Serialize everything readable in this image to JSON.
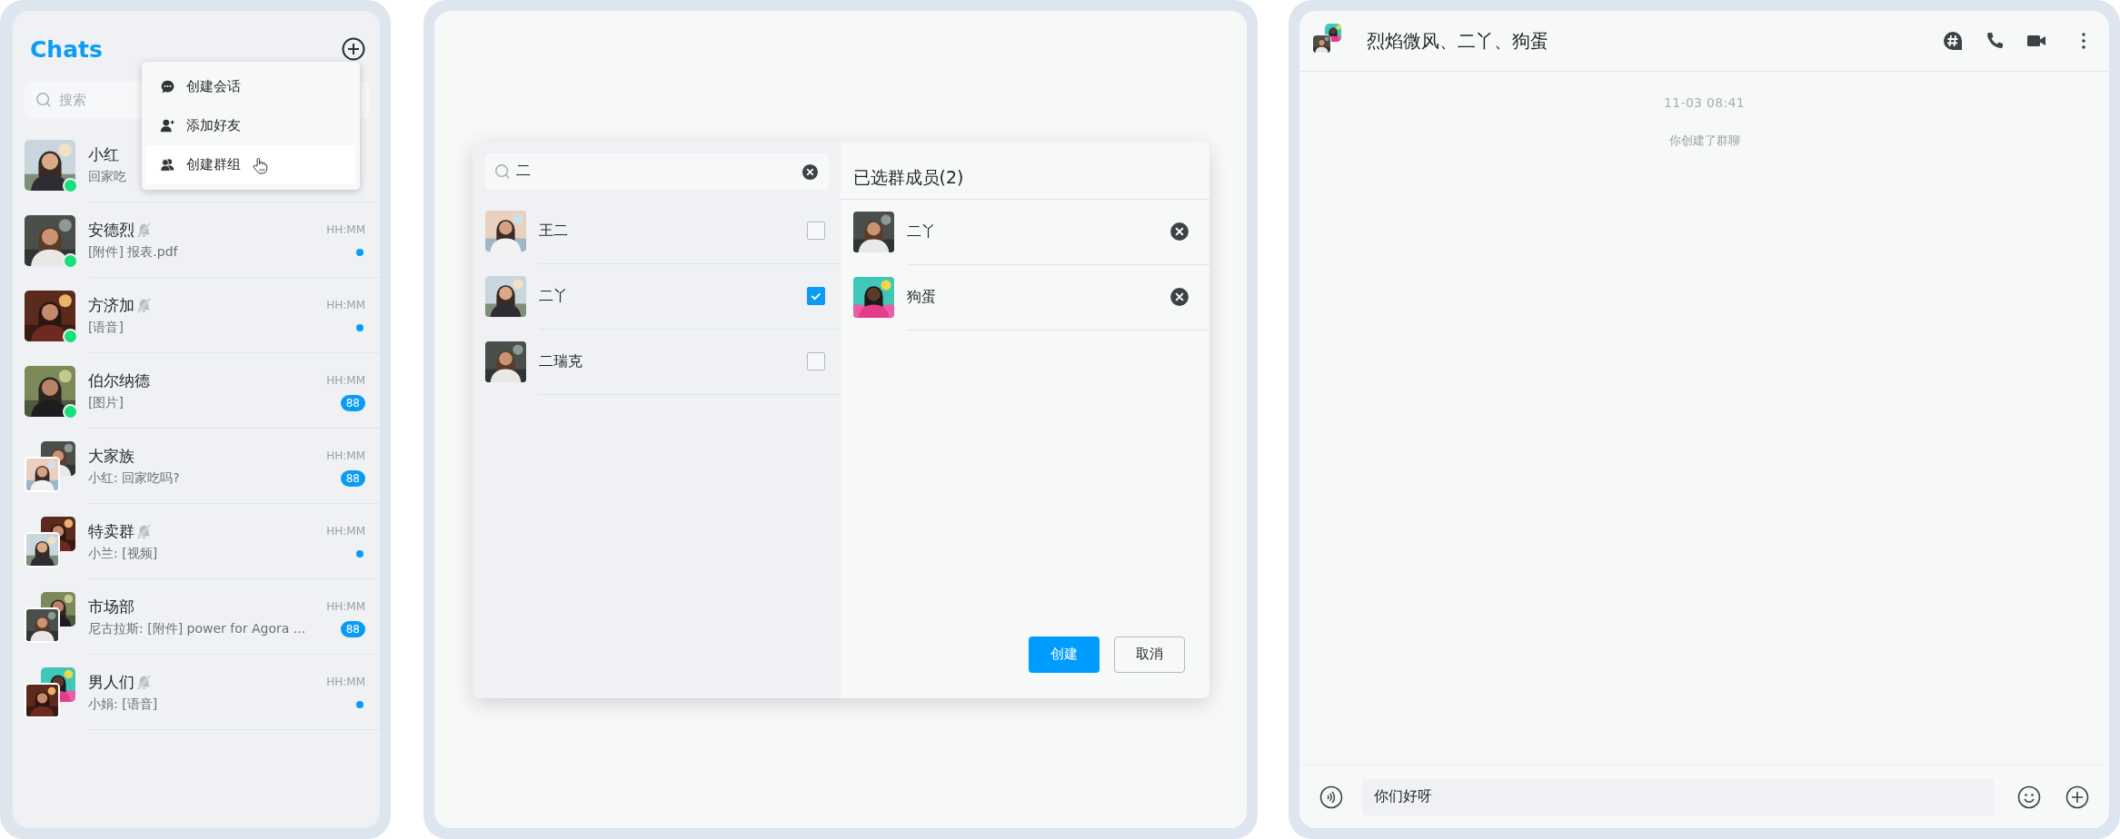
{
  "chat_list": {
    "title": "Chats",
    "search": {
      "placeholder": "搜索"
    },
    "menu": [
      {
        "label": "创建会话",
        "kind": "chat",
        "selected": false
      },
      {
        "label": "添加好友",
        "kind": "add_friend",
        "selected": false
      },
      {
        "label": "创建群组",
        "kind": "group",
        "selected": true
      }
    ],
    "chats": [
      {
        "name": "小红",
        "preview": "回家吃",
        "group_avatar": false,
        "online": true,
        "muted": false
      },
      {
        "name": "安德烈",
        "preview": "[附件] 报表.pdf",
        "time": "HH:MM",
        "group_avatar": false,
        "online": true,
        "muted": true,
        "unread": {
          "kind": "dot"
        }
      },
      {
        "name": "方济加",
        "preview": "[语音]",
        "time": "HH:MM",
        "group_avatar": false,
        "online": true,
        "muted": true,
        "unread": {
          "kind": "dot"
        }
      },
      {
        "name": "伯尔纳德",
        "preview": "[图片]",
        "time": "HH:MM",
        "group_avatar": false,
        "online": true,
        "muted": false,
        "unread": {
          "kind": "count",
          "count": "88"
        }
      },
      {
        "name": "大家族",
        "preview": "小红: 回家吃吗?",
        "time": "HH:MM",
        "group_avatar": true,
        "online": false,
        "muted": false,
        "unread": {
          "kind": "count",
          "count": "88"
        }
      },
      {
        "name": "特卖群",
        "preview": "小兰: [视频]",
        "time": "HH:MM",
        "group_avatar": true,
        "online": false,
        "muted": true,
        "unread": {
          "kind": "dot"
        }
      },
      {
        "name": "市场部",
        "preview": "尼古拉斯: [附件] power for Agora ...",
        "time": "HH:MM",
        "group_avatar": true,
        "online": false,
        "muted": false,
        "unread": {
          "kind": "count",
          "count": "88"
        }
      },
      {
        "name": "男人们",
        "preview": "小娟: [语音]",
        "time": "HH:MM",
        "group_avatar": true,
        "online": false,
        "muted": true,
        "unread": {
          "kind": "dot"
        }
      }
    ]
  },
  "group_dialog": {
    "search": {
      "value": "二"
    },
    "contacts": [
      {
        "name": "王二",
        "checked": false
      },
      {
        "name": "二丫",
        "checked": true
      },
      {
        "name": "二瑞克",
        "checked": false
      }
    ],
    "selected_title": "已选群成员(2)",
    "selected_members": [
      {
        "name": "二丫"
      },
      {
        "name": "狗蛋"
      }
    ],
    "buttons": [
      {
        "label": "创建",
        "kind": "primary"
      },
      {
        "label": "取消",
        "kind": "secondary"
      }
    ]
  },
  "conversation": {
    "title": "烈焰微风、二丫、狗蛋",
    "messages": [
      {
        "kind": "time",
        "text": "11-03 08:41"
      },
      {
        "kind": "system",
        "text": "你创建了群聊"
      }
    ],
    "composer": {
      "value": "你们好呀"
    }
  }
}
